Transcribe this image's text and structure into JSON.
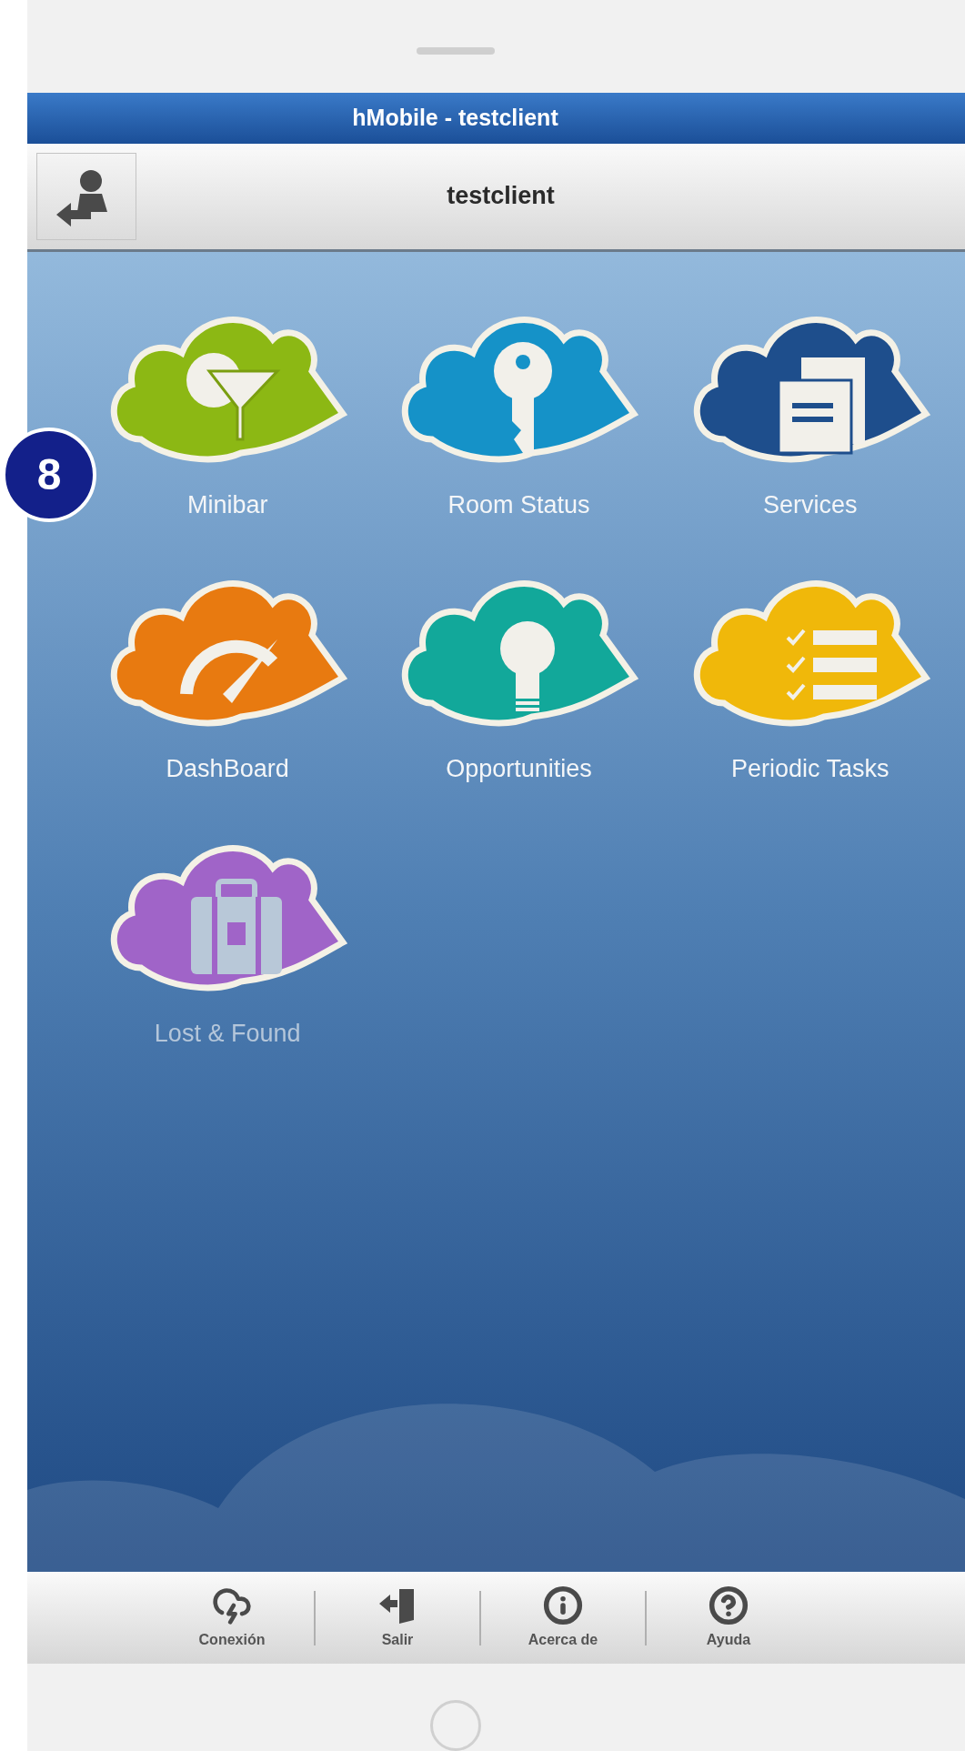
{
  "window": {
    "title": "hMobile - testclient"
  },
  "toolbar": {
    "title": "testclient"
  },
  "tiles": [
    {
      "label": "Minibar",
      "kind": "glass",
      "color": "#8cb814",
      "disabled": false
    },
    {
      "label": "Room Status",
      "kind": "key",
      "color": "#1592c8",
      "disabled": false
    },
    {
      "label": "Services",
      "kind": "document",
      "color": "#1e4e8c",
      "disabled": false
    },
    {
      "label": "DashBoard",
      "kind": "gauge",
      "color": "#e87a10",
      "disabled": false
    },
    {
      "label": "Opportunities",
      "kind": "bulb",
      "color": "#12a89a",
      "disabled": false
    },
    {
      "label": "Periodic Tasks",
      "kind": "checklist",
      "color": "#f0b80a",
      "disabled": false
    },
    {
      "label": "Lost & Found",
      "kind": "suitcase",
      "color": "#a064c8",
      "disabled": true
    }
  ],
  "callout_badge": "8",
  "bottom_bar": [
    {
      "label": "Conexión",
      "kind": "connection"
    },
    {
      "label": "Salir",
      "kind": "exit"
    },
    {
      "label": "Acerca de",
      "kind": "about"
    },
    {
      "label": "Ayuda",
      "kind": "help"
    }
  ]
}
